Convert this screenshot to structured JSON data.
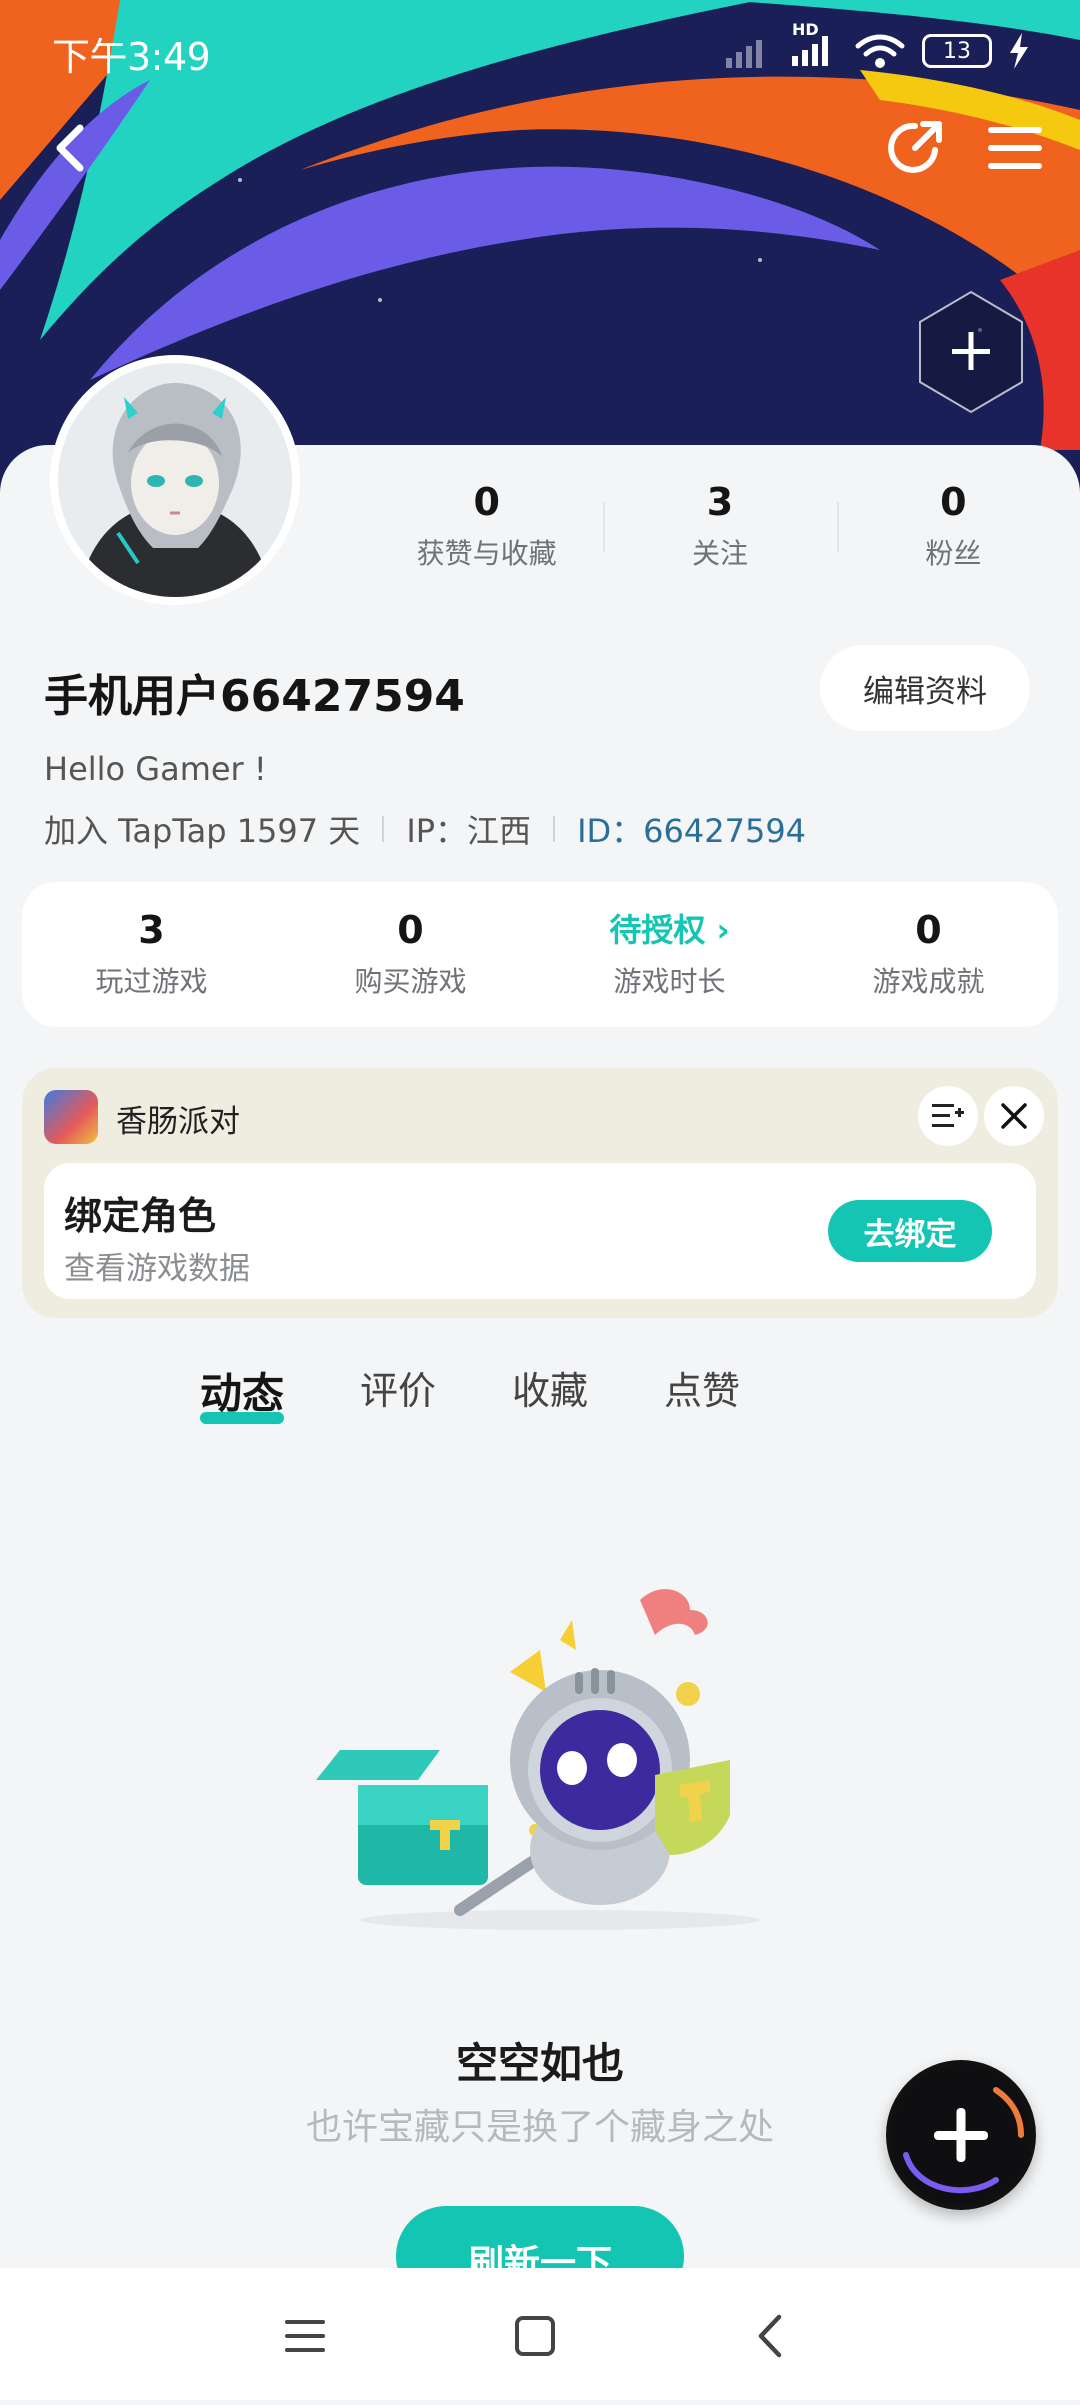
{
  "status_bar": {
    "time": "下午3:49",
    "network_label": "HD",
    "battery_level": "13"
  },
  "profile": {
    "stats": [
      {
        "value": "0",
        "label": "获赞与收藏"
      },
      {
        "value": "3",
        "label": "关注"
      },
      {
        "value": "0",
        "label": "粉丝"
      }
    ],
    "username": "手机用户66427594",
    "edit_button": "编辑资料",
    "bio": "Hello Gamer !",
    "joined": "加入 TapTap 1597 天",
    "ip": "IP：江西",
    "id_label": "ID：",
    "id_value": "66427594"
  },
  "game_stats": [
    {
      "value": "3",
      "label": "玩过游戏"
    },
    {
      "value": "0",
      "label": "购买游戏"
    },
    {
      "value": "待授权 ›",
      "label": "游戏时长"
    },
    {
      "value": "0",
      "label": "游戏成就"
    }
  ],
  "bind_card": {
    "app_name": "香肠派对",
    "title": "绑定角色",
    "subtitle": "查看游戏数据",
    "button": "去绑定"
  },
  "tabs": [
    "动态",
    "评价",
    "收藏",
    "点赞"
  ],
  "empty_state": {
    "title": "空空如也",
    "subtitle": "也许宝藏只是换了个藏身之处",
    "button": "刷新一下"
  },
  "colors": {
    "accent": "#15c5b3",
    "header_bg": "#1a1f57",
    "id_text": "#2a6f97"
  },
  "icons": [
    "back-icon",
    "share-icon",
    "menu-icon",
    "hex-add-icon",
    "wifi-icon",
    "charging-icon",
    "sort-icon",
    "close-icon",
    "plus-icon",
    "nav-menu-icon",
    "nav-home-icon",
    "nav-back-icon"
  ]
}
